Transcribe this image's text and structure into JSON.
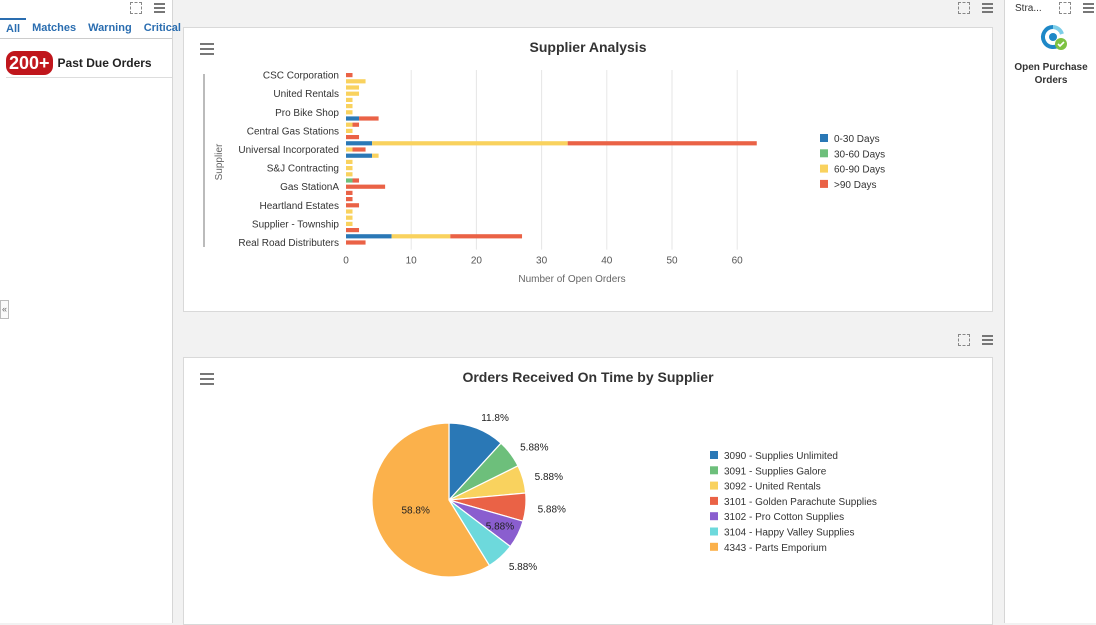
{
  "left": {
    "tabs": [
      "All",
      "Matches",
      "Warning",
      "Critical"
    ],
    "alert": {
      "badge": "200+",
      "label": "Past Due Orders"
    }
  },
  "right": {
    "title": "Stra...",
    "item_label": "Open Purchase Orders"
  },
  "colors": {
    "d0_30": "#2a78b6",
    "d30_60": "#6dbf7b",
    "d60_90": "#f9d25e",
    "d90": "#ea6246"
  },
  "chart_data": [
    {
      "type": "bar",
      "orientation": "horizontal",
      "stacked": true,
      "title": "Supplier Analysis",
      "xlabel": "Number of Open Orders",
      "ylabel": "Supplier",
      "xlim": [
        0,
        65
      ],
      "xticks": [
        0,
        10,
        20,
        30,
        40,
        50,
        60
      ],
      "legend_position": "right",
      "category_labels": [
        "CSC Corporation",
        "United Rentals",
        "Pro Bike Shop",
        "Central Gas Stations",
        "Universal Incorporated",
        "S&J Contracting",
        "Gas StationA",
        "Heartland Estates",
        "Supplier - Township",
        "Real Road Distributers"
      ],
      "rows": [
        {
          "label": "CSC Corporation",
          "values": [
            0,
            0,
            0,
            1
          ]
        },
        {
          "label": "",
          "values": [
            0,
            0,
            3,
            0
          ]
        },
        {
          "label": "",
          "values": [
            0,
            0,
            2,
            0
          ]
        },
        {
          "label": "United Rentals",
          "values": [
            0,
            0,
            2,
            0
          ]
        },
        {
          "label": "",
          "values": [
            0,
            0,
            1,
            0
          ]
        },
        {
          "label": "",
          "values": [
            0,
            0,
            1,
            0
          ]
        },
        {
          "label": "Pro Bike Shop",
          "values": [
            0,
            0,
            1,
            0
          ]
        },
        {
          "label": "",
          "values": [
            2,
            0,
            0,
            3
          ]
        },
        {
          "label": "",
          "values": [
            0,
            0,
            1,
            1
          ]
        },
        {
          "label": "Central Gas Stations",
          "values": [
            0,
            0,
            1,
            0
          ]
        },
        {
          "label": "",
          "values": [
            0,
            0,
            0,
            2
          ]
        },
        {
          "label": "",
          "values": [
            4,
            0,
            30,
            29
          ]
        },
        {
          "label": "Universal Incorporated",
          "values": [
            0,
            0,
            1,
            2
          ]
        },
        {
          "label": "",
          "values": [
            4,
            0,
            1,
            0
          ]
        },
        {
          "label": "",
          "values": [
            0,
            0,
            1,
            0
          ]
        },
        {
          "label": "S&J Contracting",
          "values": [
            0,
            0,
            1,
            0
          ]
        },
        {
          "label": "",
          "values": [
            0,
            0,
            1,
            0
          ]
        },
        {
          "label": "",
          "values": [
            0,
            1,
            0,
            1
          ]
        },
        {
          "label": "Gas StationA",
          "values": [
            0,
            0,
            0,
            6
          ]
        },
        {
          "label": "",
          "values": [
            0,
            0,
            0,
            1
          ]
        },
        {
          "label": "",
          "values": [
            0,
            0,
            0,
            1
          ]
        },
        {
          "label": "Heartland Estates",
          "values": [
            0,
            0,
            0,
            2
          ]
        },
        {
          "label": "",
          "values": [
            0,
            0,
            1,
            0
          ]
        },
        {
          "label": "",
          "values": [
            0,
            0,
            1,
            0
          ]
        },
        {
          "label": "Supplier - Township",
          "values": [
            0,
            0,
            1,
            0
          ]
        },
        {
          "label": "",
          "values": [
            0,
            0,
            0,
            2
          ]
        },
        {
          "label": "",
          "values": [
            7,
            0,
            9,
            11
          ]
        },
        {
          "label": "Real Road Distributers",
          "values": [
            0,
            0,
            0,
            3
          ]
        }
      ],
      "series": [
        {
          "name": "0-30 Days",
          "color": "#2a78b6"
        },
        {
          "name": "30-60 Days",
          "color": "#6dbf7b"
        },
        {
          "name": "60-90 Days",
          "color": "#f9d25e"
        },
        {
          "name": ">90 Days",
          "color": "#ea6246"
        }
      ]
    },
    {
      "type": "pie",
      "title": "Orders Received On Time by Supplier",
      "legend_position": "right",
      "slices": [
        {
          "label": "3090 - Supplies Unlimited",
          "value": 11.8,
          "display": "11.8%",
          "color": "#2a78b6"
        },
        {
          "label": "3091 - Supplies Galore",
          "value": 5.88,
          "display": "5.88%",
          "color": "#6dbf7b"
        },
        {
          "label": "3092 - United Rentals",
          "value": 5.88,
          "display": "5.88%",
          "color": "#f9d25e"
        },
        {
          "label": "3101 - Golden Parachute Supplies",
          "value": 5.88,
          "display": "5.88%",
          "color": "#ea6246"
        },
        {
          "label": "3102 - Pro Cotton Supplies",
          "value": 5.88,
          "display": "5.88%",
          "color": "#8a5ecf"
        },
        {
          "label": "3104 - Happy Valley Supplies",
          "value": 5.88,
          "display": "5.88%",
          "color": "#6dd9dc"
        },
        {
          "label": "4343 - Parts Emporium",
          "value": 58.8,
          "display": "58.8%",
          "color": "#fbb14b"
        }
      ]
    }
  ]
}
